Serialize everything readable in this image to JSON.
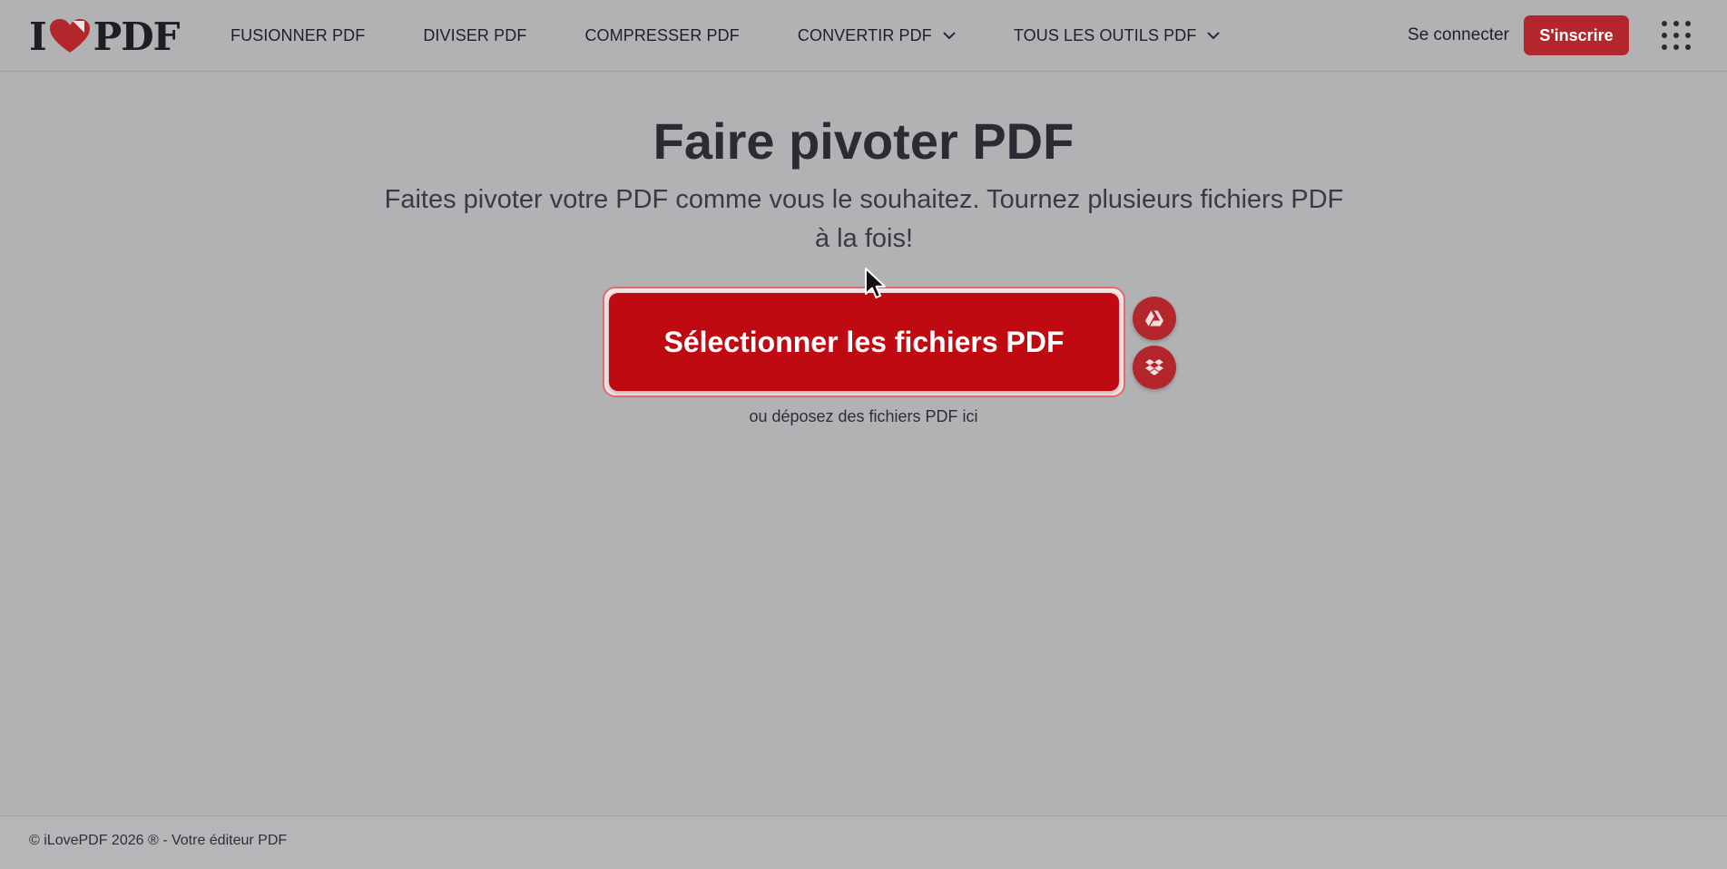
{
  "brand": {
    "logo_left": "I",
    "logo_right": "PDF",
    "accent_color": "#b3262b",
    "primary_button_color": "#bf0a11"
  },
  "nav": {
    "items": [
      {
        "label": "FUSIONNER PDF"
      },
      {
        "label": "DIVISER PDF"
      },
      {
        "label": "COMPRESSER PDF"
      },
      {
        "label": "CONVERTIR PDF",
        "dropdown": true
      },
      {
        "label": "TOUS LES OUTILS PDF",
        "dropdown": true
      }
    ]
  },
  "header": {
    "login_label": "Se connecter",
    "signup_label": "S'inscrire",
    "apps_icon": "grid-apps-icon"
  },
  "main": {
    "title": "Faire pivoter PDF",
    "subtitle": "Faites pivoter votre PDF comme vous le souhaitez. Tournez plusieurs fichiers PDF à la fois!",
    "select_button_label": "Sélectionner les fichiers PDF",
    "drop_hint": "ou déposez des fichiers PDF ici",
    "cloud_sources": [
      {
        "icon": "google-drive-icon"
      },
      {
        "icon": "dropbox-icon"
      }
    ]
  },
  "footer": {
    "text": "© iLovePDF 2026 ® - Votre éditeur PDF"
  }
}
